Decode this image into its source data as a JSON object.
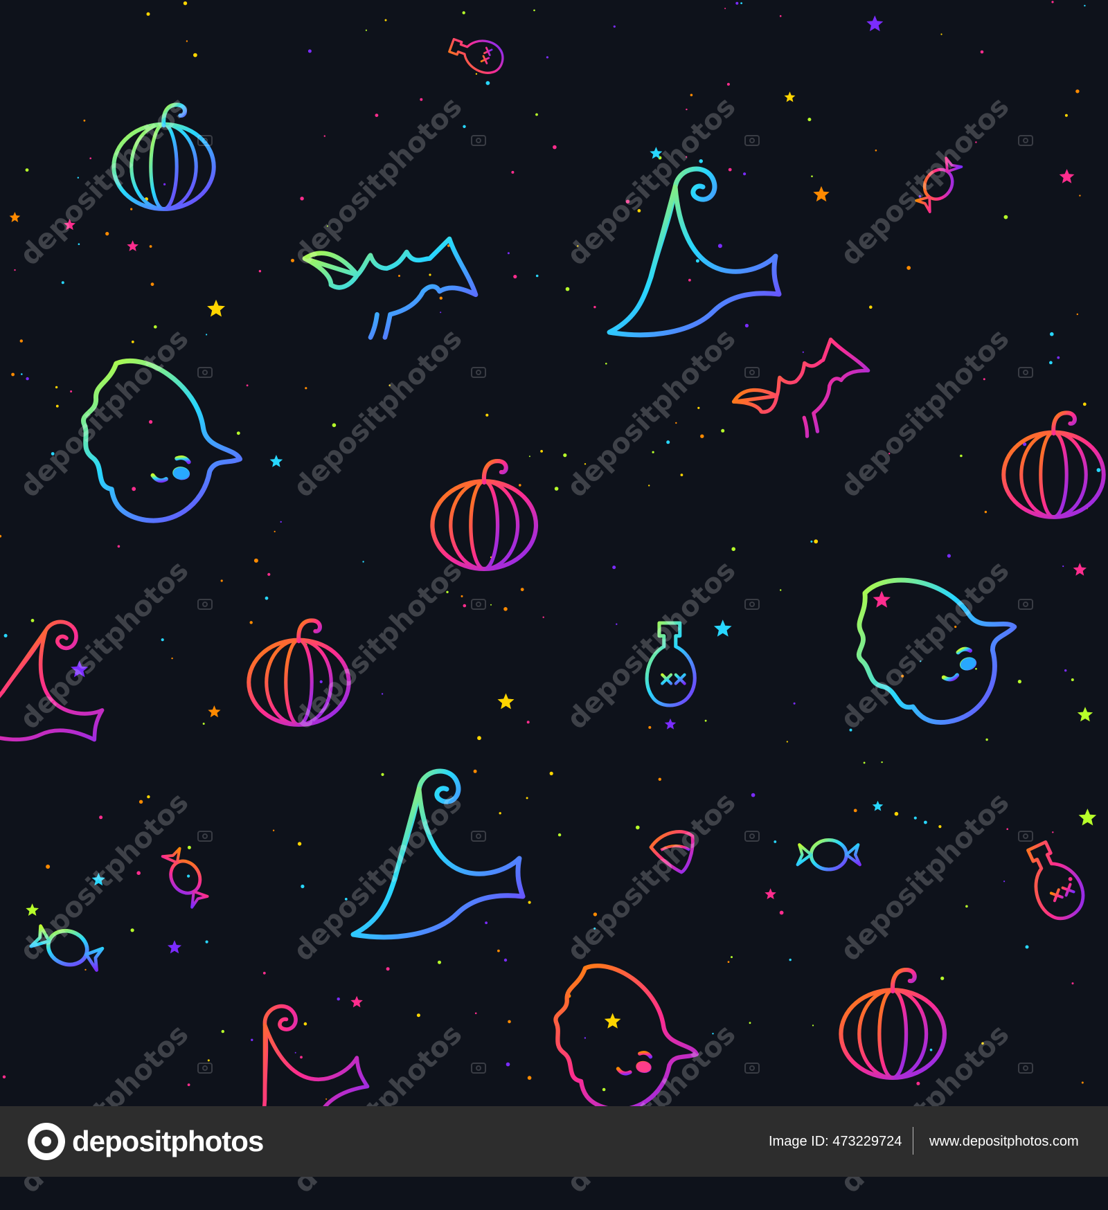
{
  "watermark": {
    "text": "depositphotos",
    "cells": [
      {
        "col": 0,
        "row": 0
      },
      {
        "col": 1,
        "row": 0
      },
      {
        "col": 2,
        "row": 0
      },
      {
        "col": 3,
        "row": 0
      },
      {
        "col": 0,
        "row": 1
      },
      {
        "col": 1,
        "row": 1
      },
      {
        "col": 2,
        "row": 1
      },
      {
        "col": 3,
        "row": 1
      },
      {
        "col": 0,
        "row": 2
      },
      {
        "col": 1,
        "row": 2
      },
      {
        "col": 2,
        "row": 2
      },
      {
        "col": 3,
        "row": 2
      },
      {
        "col": 0,
        "row": 3
      },
      {
        "col": 1,
        "row": 3
      },
      {
        "col": 2,
        "row": 3
      },
      {
        "col": 3,
        "row": 3
      },
      {
        "col": 0,
        "row": 4
      },
      {
        "col": 1,
        "row": 4
      },
      {
        "col": 2,
        "row": 4
      },
      {
        "col": 3,
        "row": 4
      }
    ]
  },
  "colors": {
    "background": "#0e121b",
    "footer": "#2d2d2d",
    "gradient_warm": [
      "#ff7a00",
      "#ff2d8e",
      "#7b2cff"
    ],
    "gradient_cool": [
      "#b7ff2a",
      "#28d7ff",
      "#7b2cff"
    ]
  },
  "illustrations": [
    {
      "kind": "ghost",
      "icon": "ghost-icon",
      "palette": "cool"
    },
    {
      "kind": "ghost",
      "icon": "ghost-icon",
      "palette": "cool"
    },
    {
      "kind": "ghost",
      "icon": "ghost-icon",
      "palette": "warm"
    },
    {
      "kind": "pumpkin",
      "icon": "pumpkin-icon",
      "palette": "cool"
    },
    {
      "kind": "pumpkin",
      "icon": "pumpkin-icon",
      "palette": "warm"
    },
    {
      "kind": "pumpkin",
      "icon": "pumpkin-icon",
      "palette": "warm"
    },
    {
      "kind": "pumpkin",
      "icon": "pumpkin-icon",
      "palette": "warm"
    },
    {
      "kind": "pumpkin",
      "icon": "pumpkin-icon",
      "palette": "warm"
    },
    {
      "kind": "bat",
      "icon": "bat-icon",
      "palette": "cool"
    },
    {
      "kind": "bat",
      "icon": "bat-icon",
      "palette": "warm"
    },
    {
      "kind": "witch-hat",
      "icon": "witch-hat-icon",
      "palette": "cool"
    },
    {
      "kind": "witch-hat",
      "icon": "witch-hat-icon",
      "palette": "cool"
    },
    {
      "kind": "witch-hat",
      "icon": "witch-hat-icon",
      "palette": "warm"
    },
    {
      "kind": "witch-hat",
      "icon": "witch-hat-icon",
      "palette": "warm"
    },
    {
      "kind": "potion",
      "icon": "potion-bottle-icon",
      "palette": "cool"
    },
    {
      "kind": "potion",
      "icon": "potion-bottle-icon",
      "palette": "warm"
    },
    {
      "kind": "potion",
      "icon": "potion-bottle-icon",
      "palette": "warm"
    },
    {
      "kind": "candy",
      "icon": "wrapped-candy-icon",
      "palette": "cool"
    },
    {
      "kind": "candy",
      "icon": "wrapped-candy-icon",
      "palette": "cool"
    },
    {
      "kind": "candy",
      "icon": "wrapped-candy-icon",
      "palette": "warm"
    },
    {
      "kind": "candy",
      "icon": "wrapped-candy-icon",
      "palette": "warm"
    },
    {
      "kind": "candy-corn",
      "icon": "candy-corn-icon",
      "palette": "warm"
    }
  ],
  "footer": {
    "logo_text": "depositphotos",
    "image_id": "Image ID: 473229724",
    "site_url": "www.depositphotos.com"
  }
}
